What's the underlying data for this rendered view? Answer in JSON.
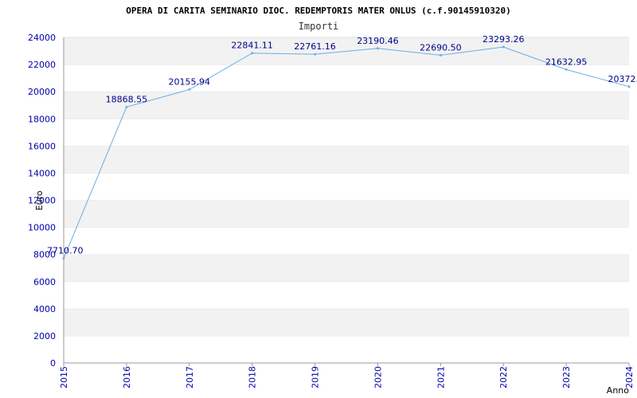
{
  "colors": {
    "line": "#6aaee8",
    "band_dark": "#f2f2f2",
    "band_light": "#ffffff",
    "tick_text": "#0000aa",
    "label_text": "#000088",
    "axis": "#999999"
  },
  "chart_data": {
    "type": "line",
    "title": "OPERA DI CARITA SEMINARIO DIOC. REDEMPTORIS MATER ONLUS (c.f.90145910320)",
    "subtitle": "Importi",
    "xlabel": "Anno",
    "ylabel": "Euro",
    "ylim": [
      0,
      24000
    ],
    "yticks": [
      "0",
      "2000",
      "4000",
      "6000",
      "8000",
      "10000",
      "12000",
      "14000",
      "16000",
      "18000",
      "20000",
      "22000",
      "24000"
    ],
    "grid": "horizontal alternating bands",
    "series": [
      {
        "x": [
          "2015",
          "2016",
          "2017",
          "2018",
          "2019",
          "2020",
          "2021",
          "2022",
          "2023",
          "2024"
        ],
        "values": [
          7710.7,
          18868.55,
          20155.94,
          22841.11,
          22761.16,
          23190.46,
          22690.5,
          23293.26,
          21632.95,
          20372.3
        ],
        "labels": [
          "7710.70",
          "18868.55",
          "20155.94",
          "22841.11",
          "22761.16",
          "23190.46",
          "22690.50",
          "23293.26",
          "21632.95",
          "20372."
        ]
      }
    ]
  }
}
